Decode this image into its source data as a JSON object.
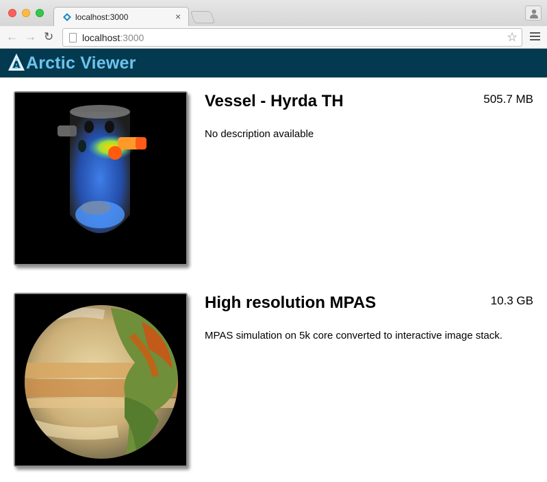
{
  "browser": {
    "tab": {
      "title": "localhost:3000",
      "close_glyph": "×"
    },
    "address": {
      "host": "localhost",
      "port": ":3000"
    },
    "icons": {
      "back": "arrow-left-icon",
      "forward": "arrow-right-icon",
      "reload": "reload-icon",
      "bookmark": "star-icon",
      "menu": "hamburger-menu-icon",
      "profile": "person-icon"
    }
  },
  "app": {
    "title": "Arctic Viewer",
    "header_color": "#033a50",
    "title_color": "#6ec3ec"
  },
  "datasets": [
    {
      "title": "Vessel - Hyrda TH",
      "size": "505.7 MB",
      "description": "No description available"
    },
    {
      "title": "High resolution MPAS",
      "size": "10.3 GB",
      "description": "MPAS simulation on 5k core converted to interactive image stack."
    }
  ]
}
